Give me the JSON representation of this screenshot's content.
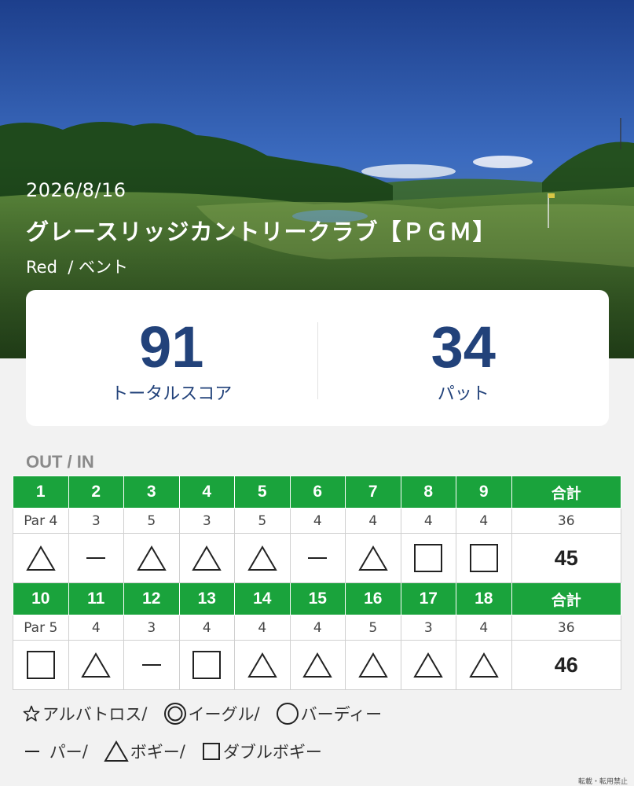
{
  "round": {
    "date": "2026/8/16",
    "course": "グレースリッジカントリークラブ【ＰＧＭ】",
    "tee": "Red",
    "green": "ベント",
    "separator": "/"
  },
  "summary": {
    "total_score": "91",
    "total_score_label": "トータルスコア",
    "putts": "34",
    "putts_label": "パット"
  },
  "section_title": "OUT / IN",
  "total_label": "合計",
  "front": {
    "holes": [
      "1",
      "2",
      "3",
      "4",
      "5",
      "6",
      "7",
      "8",
      "9"
    ],
    "pars": [
      "Par 4",
      "3",
      "5",
      "3",
      "5",
      "4",
      "4",
      "4",
      "4"
    ],
    "par_total": "36",
    "results": [
      "bogey",
      "par",
      "bogey",
      "bogey",
      "bogey",
      "par",
      "bogey",
      "double",
      "double"
    ],
    "score_total": "45"
  },
  "back": {
    "holes": [
      "10",
      "11",
      "12",
      "13",
      "14",
      "15",
      "16",
      "17",
      "18"
    ],
    "pars": [
      "Par 5",
      "4",
      "3",
      "4",
      "4",
      "4",
      "5",
      "3",
      "4"
    ],
    "par_total": "36",
    "results": [
      "double",
      "bogey",
      "par",
      "double",
      "bogey",
      "bogey",
      "bogey",
      "bogey",
      "bogey"
    ],
    "score_total": "46"
  },
  "legend": {
    "albatross": "アルバトロス",
    "eagle": "イーグル",
    "birdie": "バーディー",
    "par": "パー",
    "bogey": "ボギー",
    "double": "ダブルボギー",
    "sep": "/"
  },
  "footnote": "転載・転用禁止",
  "colors": {
    "header_green": "#1aa33c",
    "score_blue": "#22427a"
  }
}
